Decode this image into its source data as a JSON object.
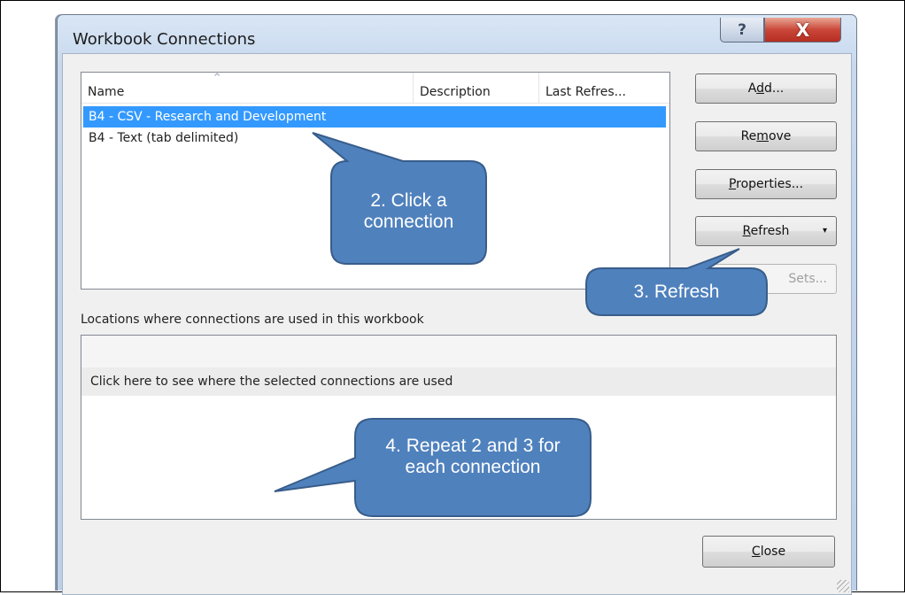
{
  "window": {
    "title": "Workbook Connections",
    "help_glyph": "?",
    "close_glyph": "X"
  },
  "connections_list": {
    "sort_glyph": "^",
    "columns": [
      "Name",
      "Description",
      "Last Refres..."
    ],
    "rows": [
      {
        "name": "B4 - CSV - Research and Development",
        "selected": true
      },
      {
        "name": "B4 - Text (tab delimited)",
        "selected": false
      }
    ]
  },
  "buttons": {
    "add": {
      "pre": "A",
      "key": "d",
      "post": "d..."
    },
    "remove": {
      "pre": "Re",
      "key": "m",
      "post": "ove"
    },
    "properties": {
      "pre": "",
      "key": "P",
      "post": "roperties..."
    },
    "refresh": {
      "pre": "",
      "key": "R",
      "post": "efresh",
      "dropdown_glyph": "▾"
    },
    "sets_visible": "Sets...",
    "close": {
      "pre": "",
      "key": "C",
      "post": "lose"
    }
  },
  "locations": {
    "label": "Locations where connections are used in this workbook",
    "hint": "Click here to see where the selected connections are used"
  },
  "callouts": {
    "step2": "2. Click a connection",
    "step3": "3. Refresh",
    "step4": "4. Repeat 2 and 3 for each connection"
  },
  "colors": {
    "callout_fill": "#4f81bd",
    "callout_stroke": "#385d8a",
    "selection": "#3399ff"
  }
}
